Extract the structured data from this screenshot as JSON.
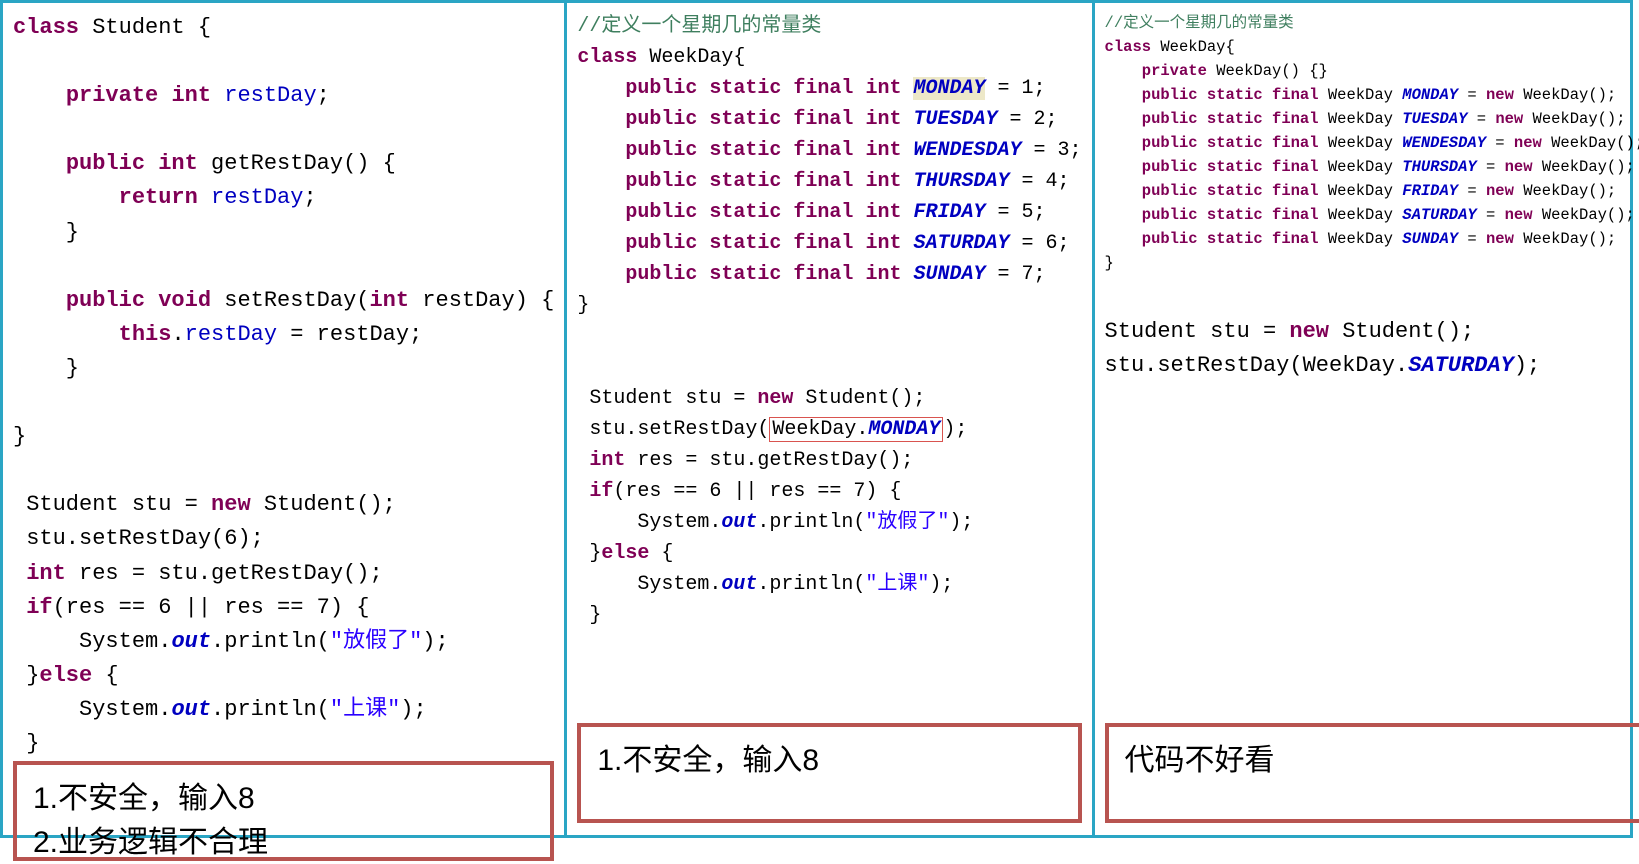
{
  "panel1": {
    "code": {
      "classDecl": "class",
      "className": "Student",
      "private": "private",
      "int": "int",
      "restDay": "restDay",
      "public": "public",
      "void": "void",
      "getRestDay": "getRestDay",
      "setRestDay": "setRestDay",
      "return": "return",
      "this": "this",
      "new": "new",
      "stuAssign": "Student stu = ",
      "stuNew": " Student();",
      "call1": "stu.setRestDay(6);",
      "intRes": " res = stu.getRestDay();",
      "if": "if",
      "cond": "(res == 6 || res == 7) {",
      "sysout": "System.",
      "out": "out",
      "println1": ".println(",
      "str1": "\"放假了\"",
      "else": "else",
      "str2": "\"上课\""
    },
    "note": {
      "line1": "1.不安全，输入8",
      "line2": "2.业务逻辑不合理"
    }
  },
  "panel2": {
    "code": {
      "comment": "//定义一个星期几的常量类",
      "classKw": "class",
      "className": "WeekDay",
      "public": "public",
      "static": "static",
      "final": "final",
      "int": "int",
      "MONDAY": "MONDAY",
      "TUESDAY": "TUESDAY",
      "WENDESDAY": "WENDESDAY",
      "THURSDAY": "THURSDAY",
      "FRIDAY": "FRIDAY",
      "SATURDAY": "SATURDAY",
      "SUNDAY": "SUNDAY",
      "v1": "1",
      "v2": "2",
      "v3": "3",
      "v4": "4",
      "v5": "5",
      "v6": "6",
      "v7": "7",
      "new": "new",
      "stuAssign": "Student stu = ",
      "stuNew": " Student();",
      "call1a": "stu.setRestDay(",
      "call1b": "WeekDay.",
      "call1c": ");",
      "intRes": " res = stu.getRestDay();",
      "if": "if",
      "cond": "(res == 6 || res == 7) {",
      "sysout": "System.",
      "out": "out",
      "println": ".println(",
      "str1": "\"放假了\"",
      "else": "else",
      "str2": "\"上课\""
    },
    "note": {
      "line1": "1.不安全，输入8"
    }
  },
  "panel3": {
    "code": {
      "comment": "//定义一个星期几的常量类",
      "classKw": "class",
      "className": "WeekDay",
      "private": "private",
      "ctor": "WeekDay() {}",
      "public": "public",
      "static": "static",
      "final": "final",
      "type": "WeekDay",
      "MONDAY": "MONDAY",
      "TUESDAY": "TUESDAY",
      "WENDESDAY": "WENDESDAY",
      "THURSDAY": "THURSDAY",
      "FRIDAY": "FRIDAY",
      "SATURDAY": "SATURDAY",
      "SUNDAY": "SUNDAY",
      "new": "new",
      "newCall": " WeekDay();",
      "stuAssign": "Student stu = ",
      "stuNew": " Student();",
      "call1a": "stu.setRestDay(WeekDay.",
      "call1c": ");"
    },
    "note": {
      "line1": "代码不好看"
    }
  }
}
